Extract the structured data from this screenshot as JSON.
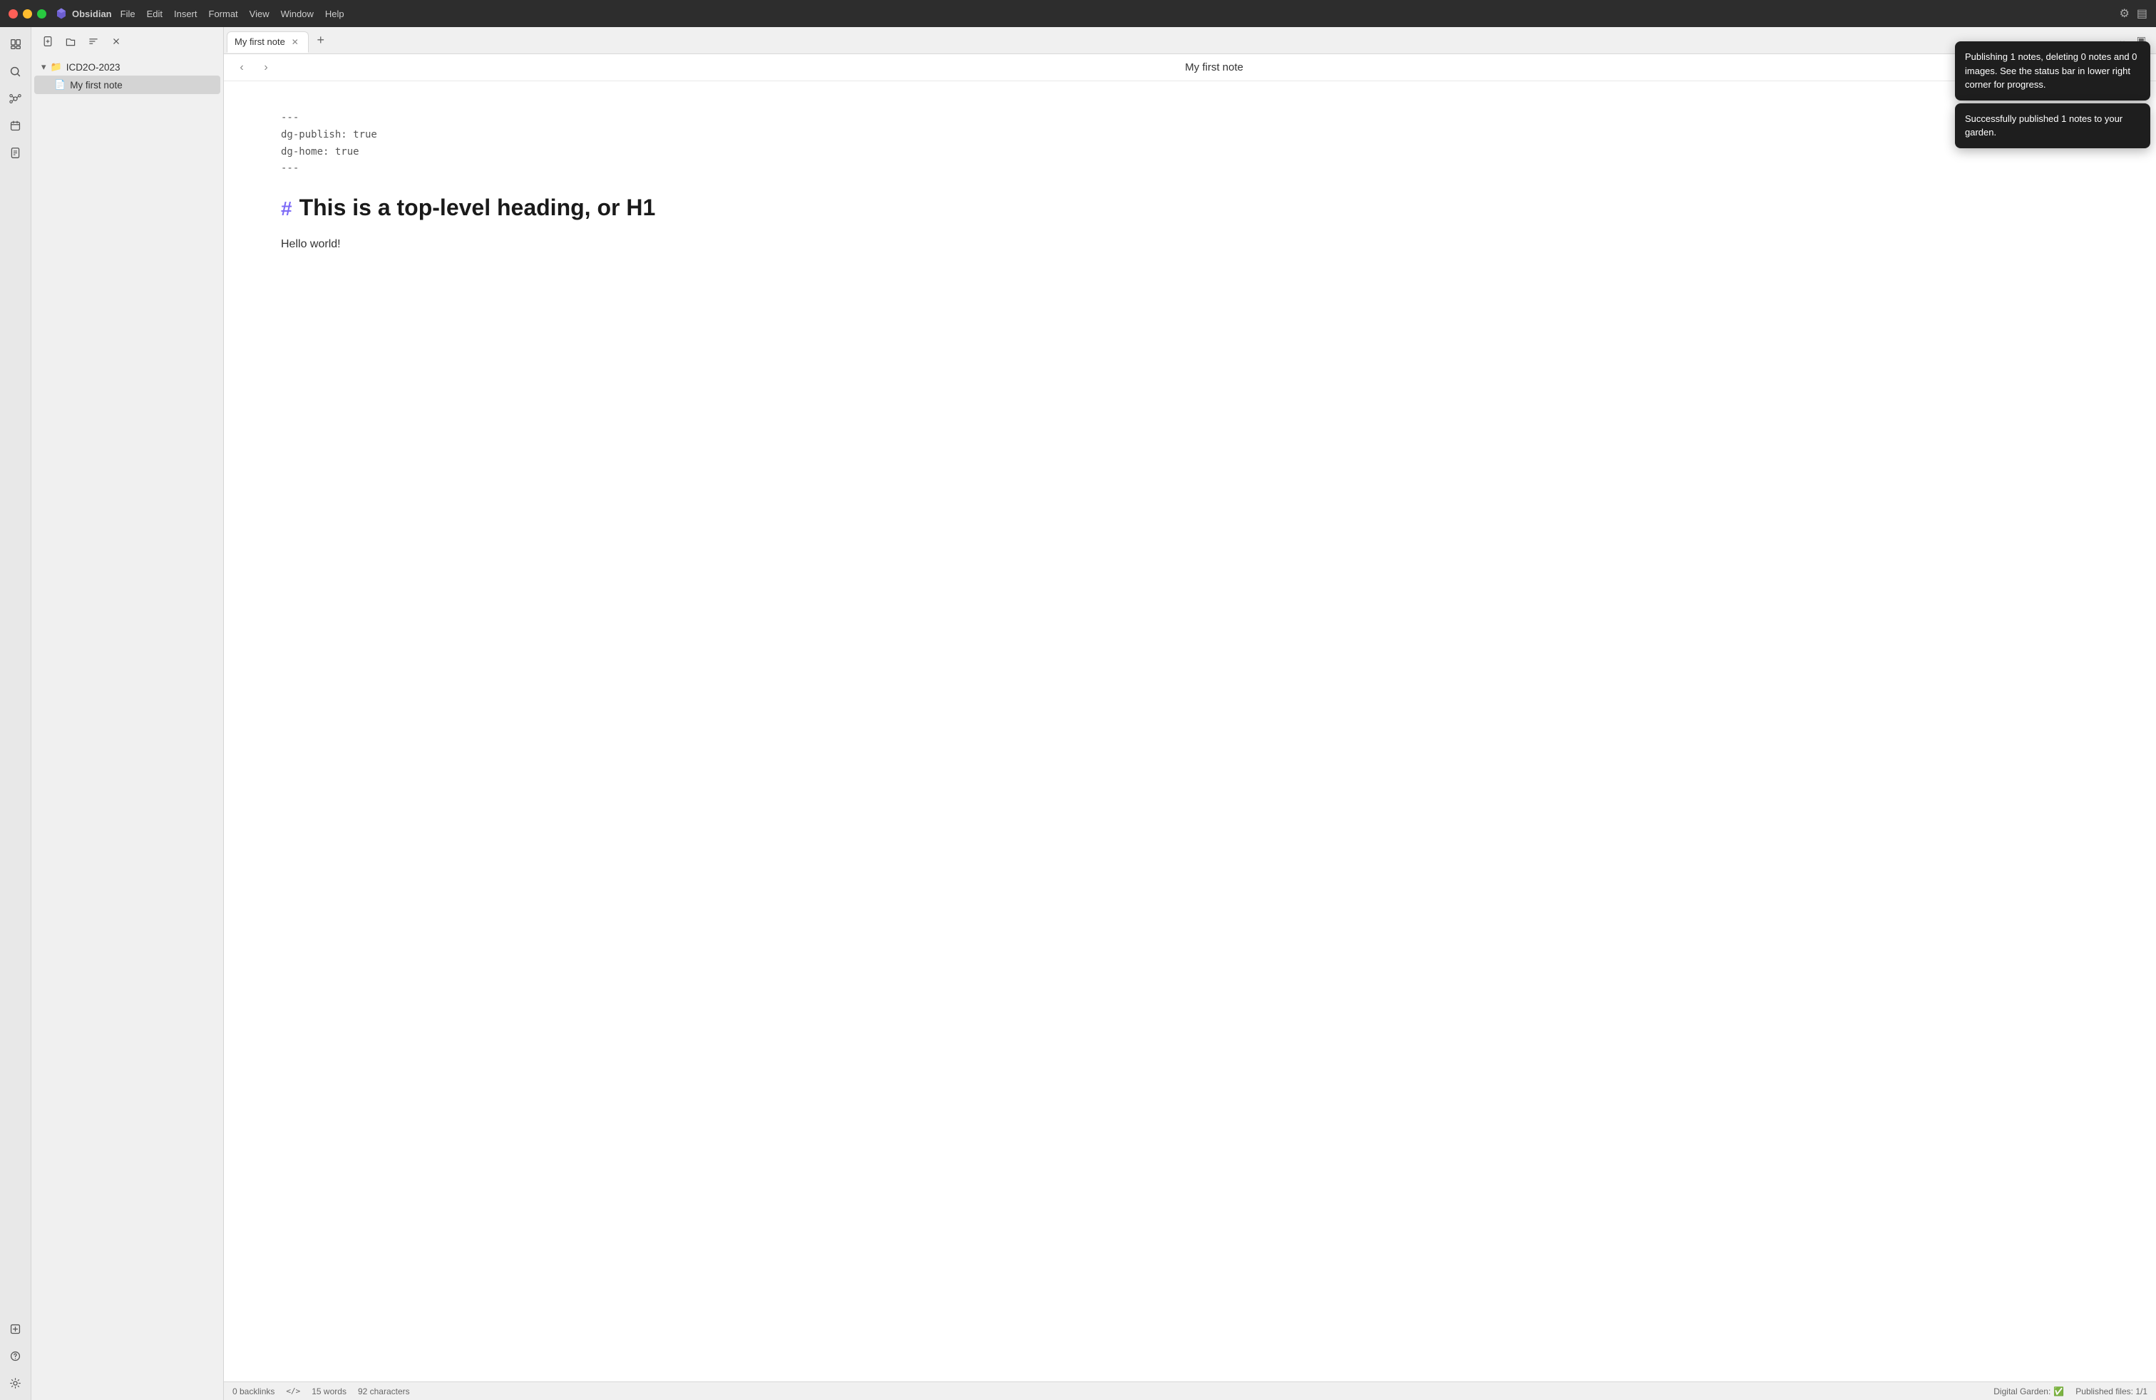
{
  "titlebar": {
    "app_name": "Obsidian",
    "menu_items": [
      "File",
      "Edit",
      "Insert",
      "Format",
      "View",
      "Window",
      "Help"
    ]
  },
  "sidebar": {
    "toolbar_icons": [
      "new-note",
      "open-folder",
      "sort",
      "collapse"
    ],
    "folder": {
      "name": "ICD2O-2023"
    },
    "files": [
      {
        "name": "My first note",
        "active": true
      }
    ]
  },
  "tab": {
    "label": "My first note",
    "add_label": "+"
  },
  "navigation": {
    "title": "My first note",
    "back_icon": "‹",
    "forward_icon": "›"
  },
  "note": {
    "frontmatter": {
      "separator1": "---",
      "line1": "dg-publish: true",
      "line2": "dg-home: true",
      "separator2": "---"
    },
    "heading": {
      "hash": "#",
      "text": "This is a top-level heading, or H1"
    },
    "body": "Hello world!"
  },
  "notifications": [
    {
      "id": "n1",
      "text": "Publishing 1 notes, deleting 0 notes and 0 images. See the status bar in lower right corner for progress."
    },
    {
      "id": "n2",
      "text": "Successfully published 1 notes to your garden."
    }
  ],
  "statusbar": {
    "backlinks": "0 backlinks",
    "code_icon": "</>",
    "words": "15 words",
    "chars": "92 characters",
    "digital_garden_label": "Digital Garden:",
    "digital_garden_status": "✅",
    "published_files": "Published files: 1/1"
  }
}
